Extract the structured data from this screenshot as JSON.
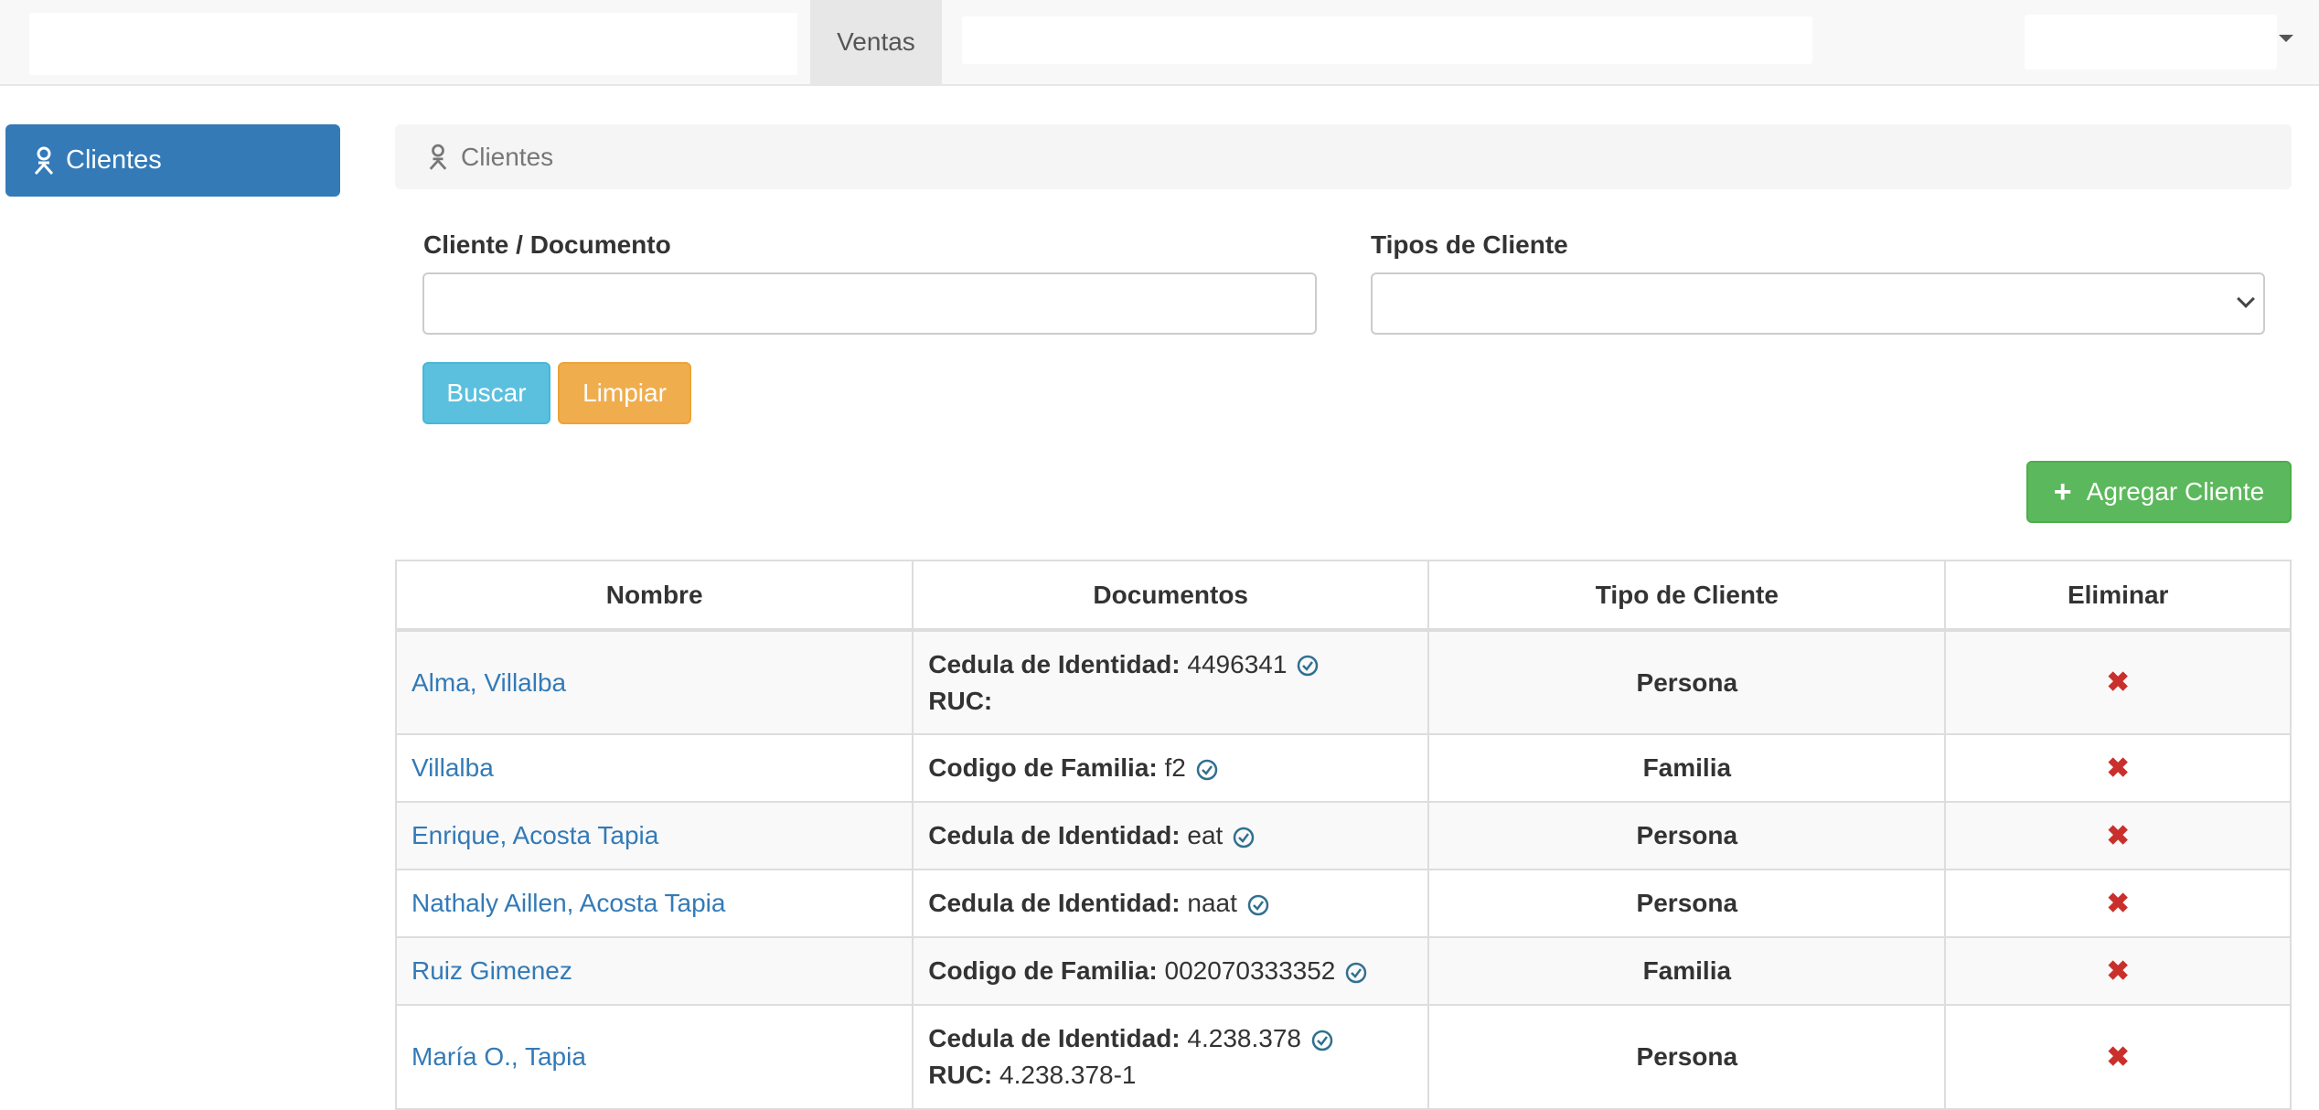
{
  "navbar": {
    "active_tab": "Ventas"
  },
  "sidebar": {
    "items": [
      {
        "label": "Clientes",
        "icon": "user-icon"
      }
    ]
  },
  "panel": {
    "title": "Clientes",
    "icon": "user-icon"
  },
  "filters": {
    "cliente_label": "Cliente / Documento",
    "cliente_value": "",
    "tipos_label": "Tipos de Cliente",
    "tipos_value": "",
    "buscar_label": "Buscar",
    "limpiar_label": "Limpiar"
  },
  "actions": {
    "add_label": "Agregar Cliente"
  },
  "table": {
    "headers": [
      "Nombre",
      "Documentos",
      "Tipo de Cliente",
      "Eliminar"
    ],
    "rows": [
      {
        "nombre": "Alma, Villalba",
        "docs": [
          {
            "label": "Cedula de Identidad:",
            "value": "4496341",
            "verified": true
          },
          {
            "label": "RUC:",
            "value": "",
            "verified": false
          }
        ],
        "tipo": "Persona"
      },
      {
        "nombre": "Villalba",
        "docs": [
          {
            "label": "Codigo de Familia:",
            "value": "f2",
            "verified": true
          }
        ],
        "tipo": "Familia"
      },
      {
        "nombre": "Enrique, Acosta Tapia",
        "docs": [
          {
            "label": "Cedula de Identidad:",
            "value": "eat",
            "verified": true
          }
        ],
        "tipo": "Persona"
      },
      {
        "nombre": "Nathaly Aillen, Acosta Tapia",
        "docs": [
          {
            "label": "Cedula de Identidad:",
            "value": "naat",
            "verified": true
          }
        ],
        "tipo": "Persona"
      },
      {
        "nombre": "Ruiz Gimenez",
        "docs": [
          {
            "label": "Codigo de Familia:",
            "value": "002070333352",
            "verified": true
          }
        ],
        "tipo": "Familia"
      },
      {
        "nombre": "María O., Tapia",
        "docs": [
          {
            "label": "Cedula de Identidad:",
            "value": "4.238.378",
            "verified": true
          },
          {
            "label": "RUC:",
            "value": "4.238.378-1",
            "verified": false
          }
        ],
        "tipo": "Persona"
      }
    ]
  },
  "colors": {
    "primary": "#337ab7",
    "info": "#5bc0de",
    "warning": "#f0ad4e",
    "success": "#5cb85c",
    "danger": "#c9302c",
    "verified": "#31708f"
  }
}
